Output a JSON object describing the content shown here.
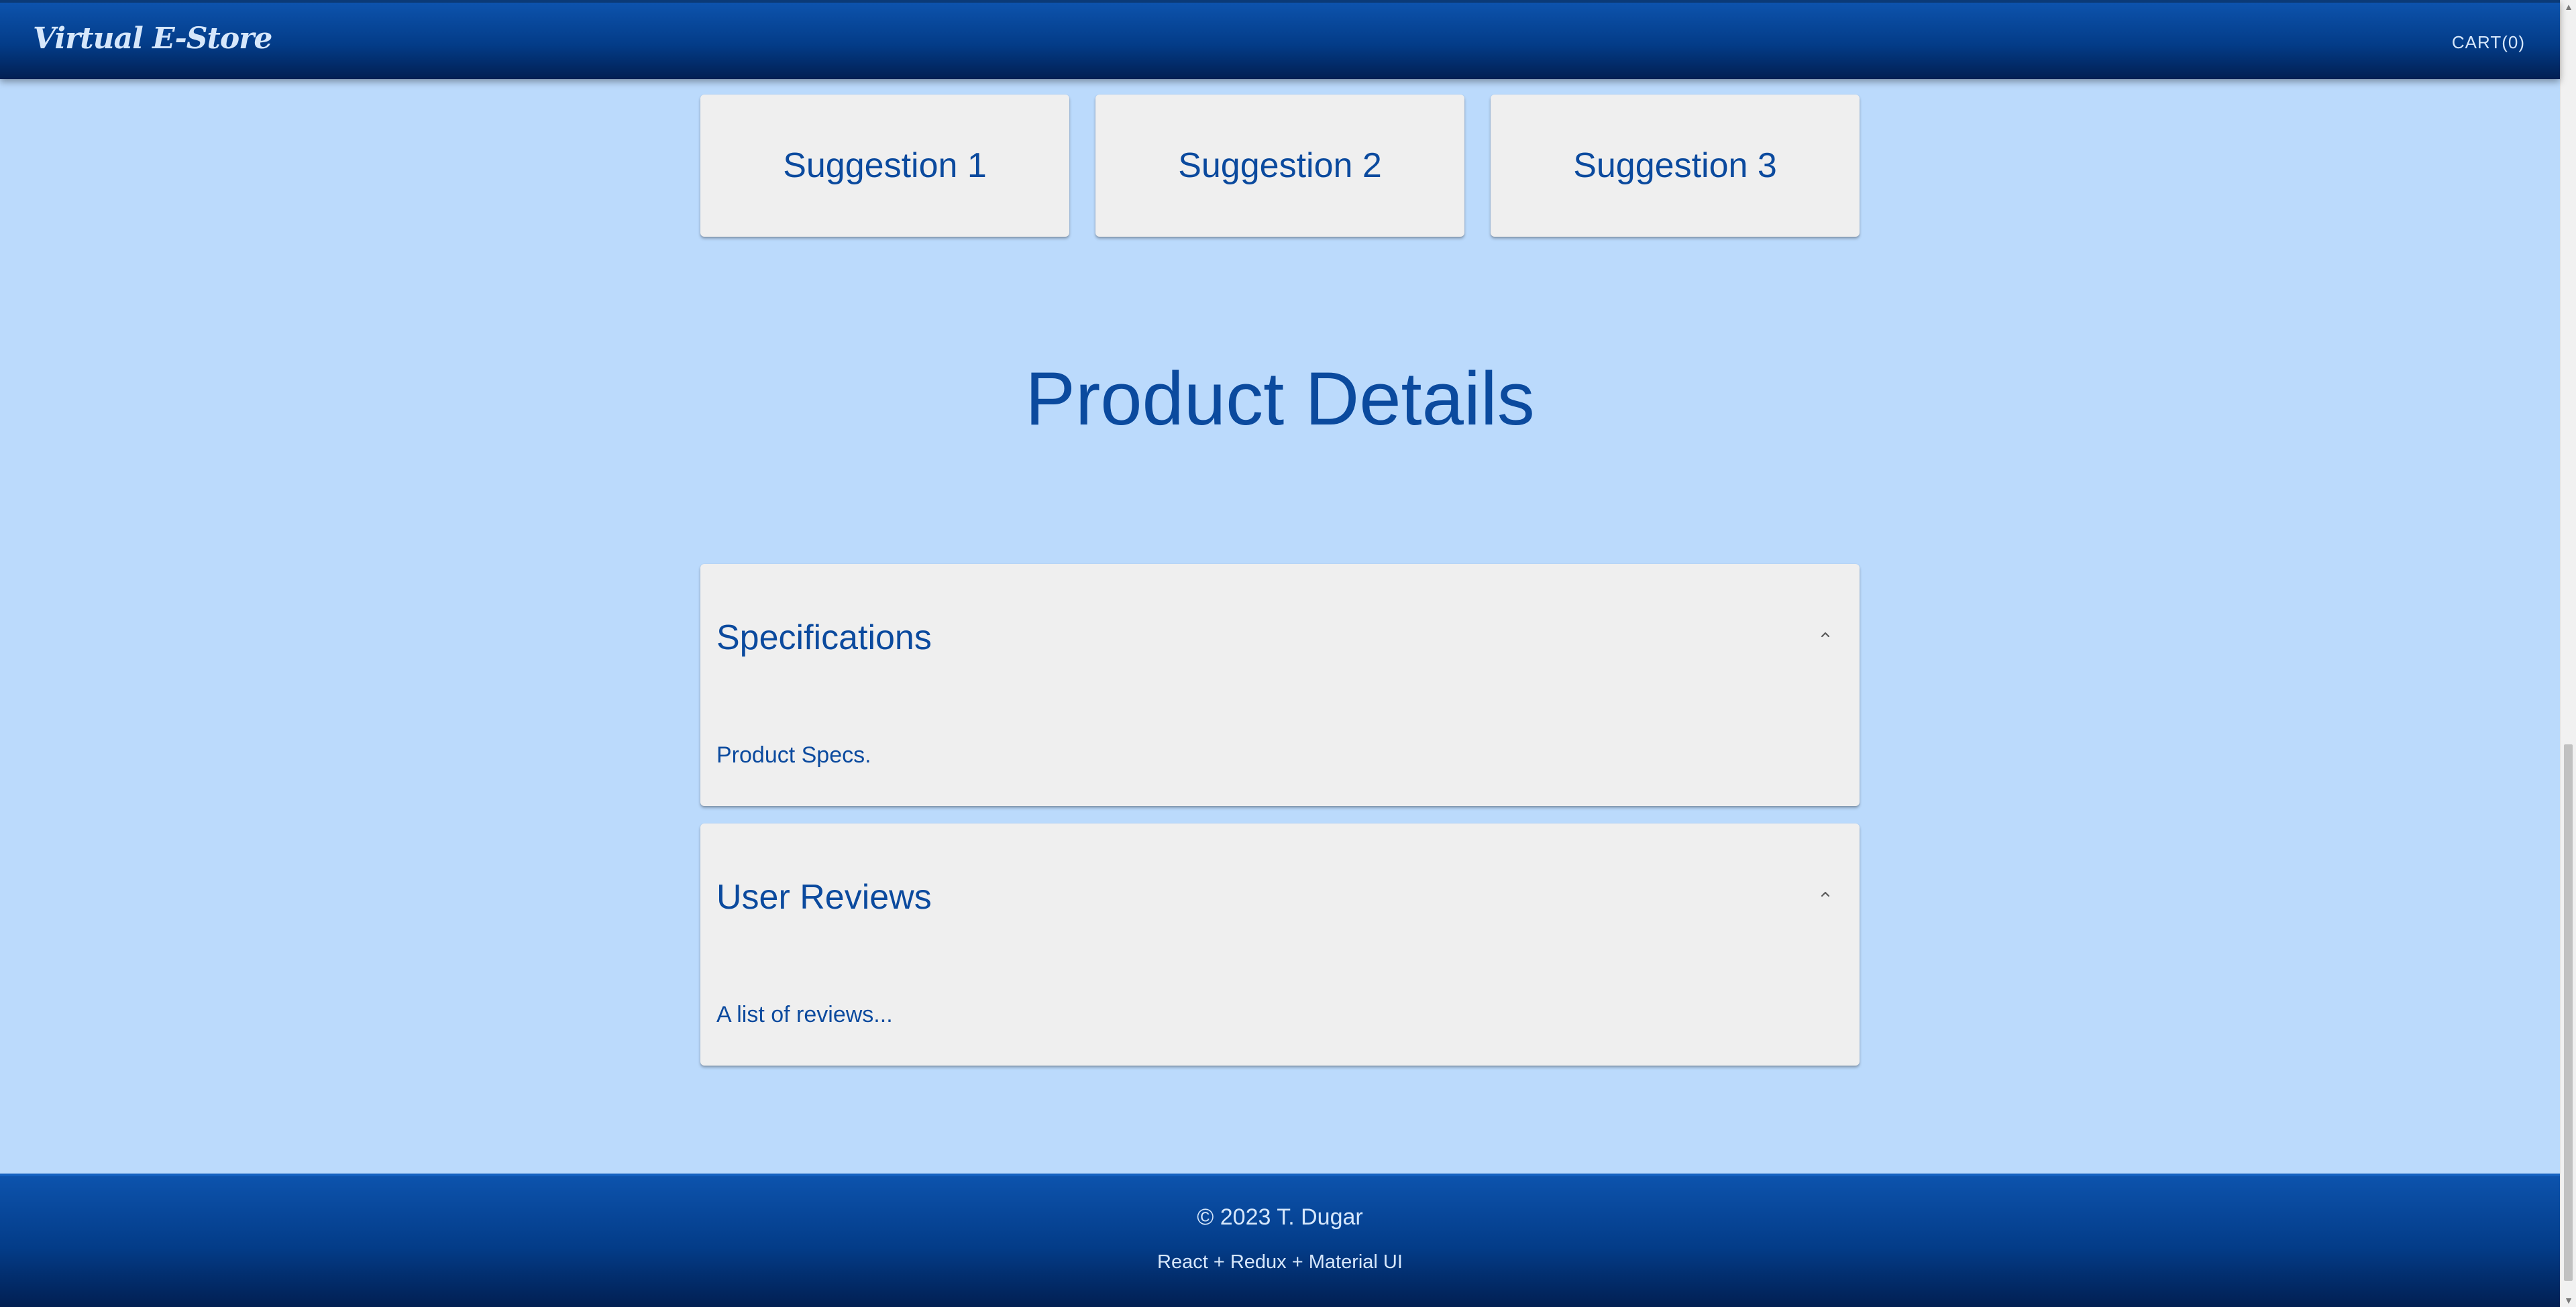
{
  "header": {
    "brand": "Virtual E-Store",
    "cart_label": "CART(0)"
  },
  "suggestions": [
    {
      "label": "Suggestion 1"
    },
    {
      "label": "Suggestion 2"
    },
    {
      "label": "Suggestion 3"
    }
  ],
  "product_details": {
    "title": "Product Details",
    "sections": [
      {
        "title": "Specifications",
        "body": "Product Specs.",
        "expanded": true,
        "icon": "chevron-up-icon"
      },
      {
        "title": "User Reviews",
        "body": "A list of reviews...",
        "expanded": true,
        "icon": "chevron-up-icon"
      }
    ]
  },
  "footer": {
    "copyright": "© 2023 T. Dugar",
    "stack": "React + Redux + Material UI"
  },
  "colors": {
    "background": "#bbdafc",
    "appbar": "#033c88",
    "accent_text": "#0b4a9e",
    "card": "#efefef"
  }
}
